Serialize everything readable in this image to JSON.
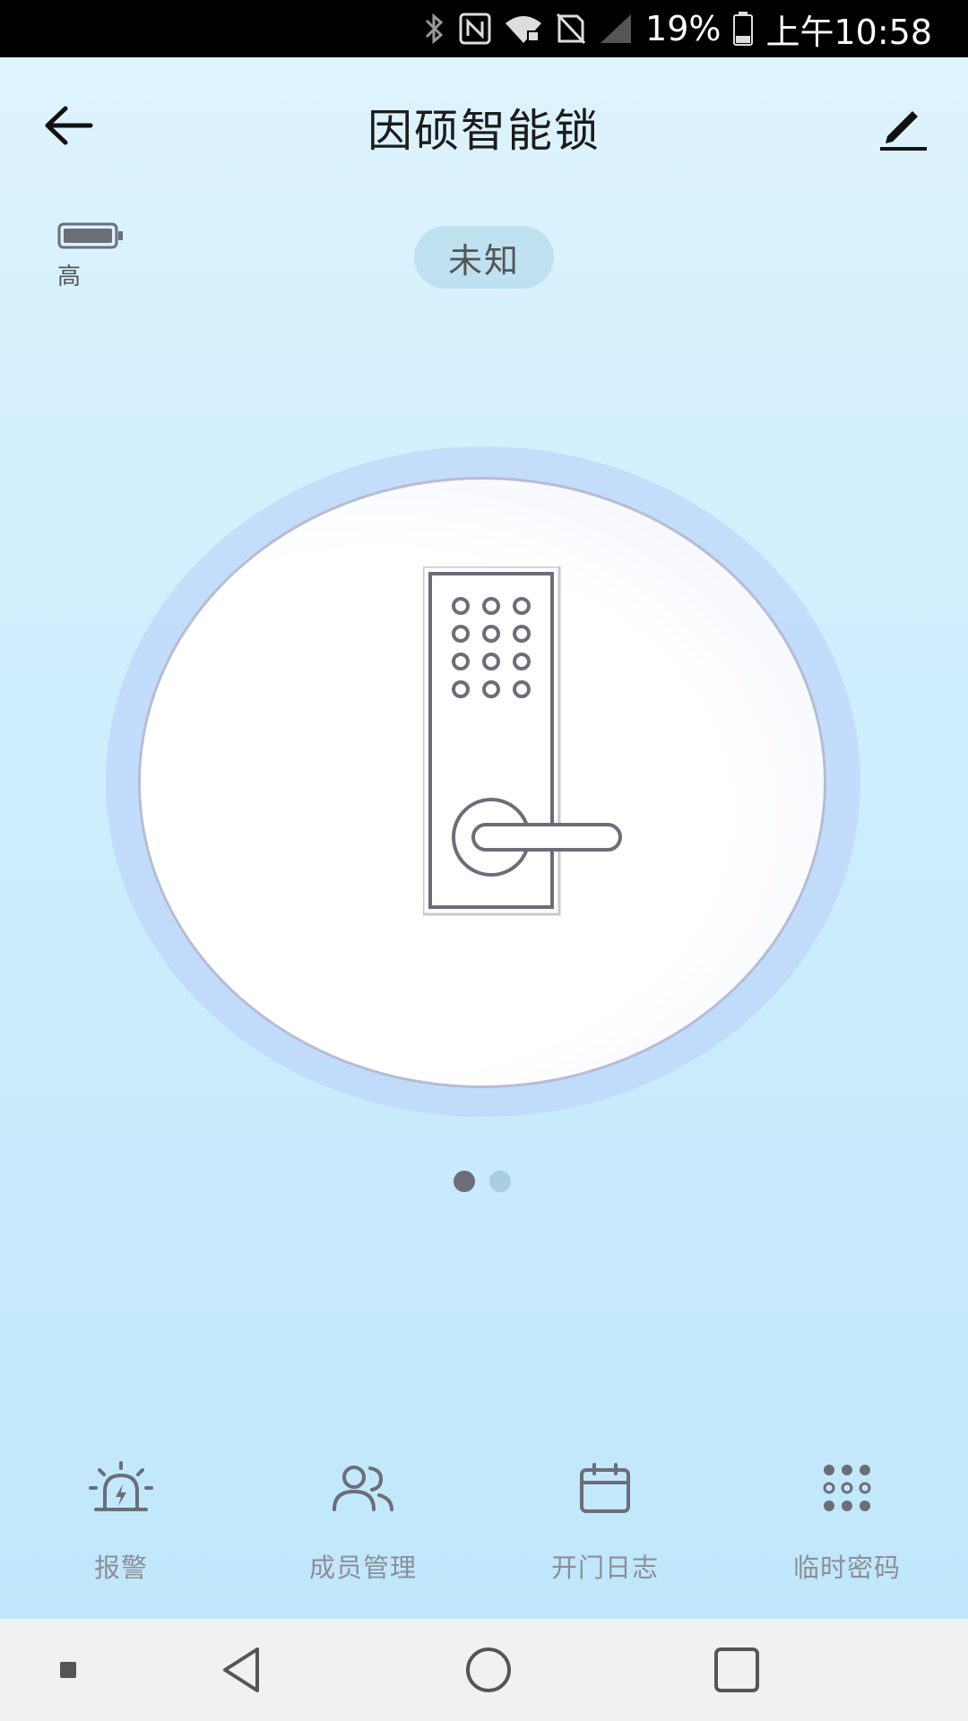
{
  "status_bar": {
    "battery_percent": "19%",
    "time": "上午10:58",
    "icons": [
      "bluetooth-icon",
      "nfc-icon",
      "wifi-locked-icon",
      "no-sim-icon",
      "signal-icon",
      "battery-icon"
    ]
  },
  "header": {
    "title": "因硕智能锁",
    "back_icon": "arrow-left-icon",
    "edit_icon": "pencil-icon"
  },
  "battery": {
    "level_label": "高",
    "level_fraction": 1.0
  },
  "lock_status": {
    "label": "未知"
  },
  "pager": {
    "page_count": 2,
    "active_index": 0
  },
  "actions": [
    {
      "label": "报警",
      "icon": "alarm-siren-icon"
    },
    {
      "label": "成员管理",
      "icon": "members-icon"
    },
    {
      "label": "开门日志",
      "icon": "calendar-icon"
    },
    {
      "label": "临时密码",
      "icon": "keypad-icon"
    }
  ],
  "colors": {
    "accent_dark": "#6b6e78",
    "label_gray": "#8a8f97",
    "ring": "#bed7fa"
  }
}
